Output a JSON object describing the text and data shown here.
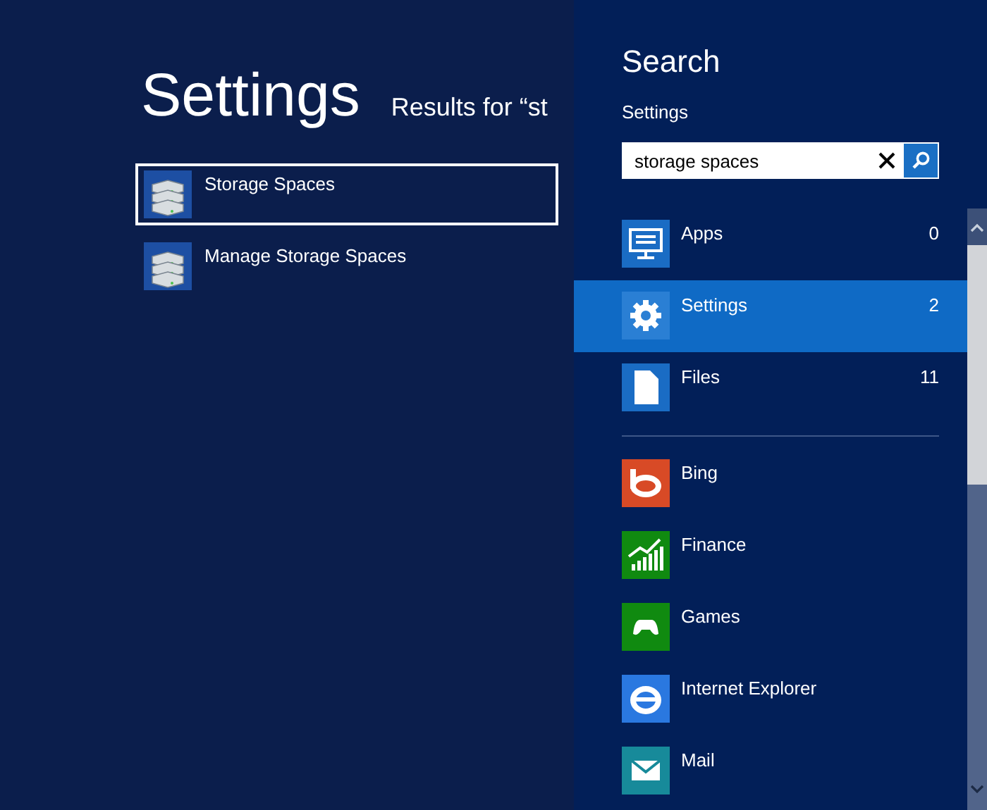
{
  "heading": "Settings",
  "results_for": "Results for “st",
  "results": [
    {
      "label": "Storage Spaces",
      "selected": true
    },
    {
      "label": "Manage Storage Spaces",
      "selected": false
    }
  ],
  "search": {
    "title": "Search",
    "scope": "Settings",
    "value": "storage spaces",
    "categories": [
      {
        "kind": "apps",
        "label": "Apps",
        "count": "0",
        "selected": false
      },
      {
        "kind": "settings",
        "label": "Settings",
        "count": "2",
        "selected": true
      },
      {
        "kind": "files",
        "label": "Files",
        "count": "11",
        "selected": false
      }
    ],
    "apps": [
      {
        "kind": "bing",
        "label": "Bing",
        "color": "#d84a26"
      },
      {
        "kind": "finance",
        "label": "Finance",
        "color": "#108a10"
      },
      {
        "kind": "games",
        "label": "Games",
        "color": "#108a10"
      },
      {
        "kind": "ie",
        "label": "Internet Explorer",
        "color": "#2a78e0"
      },
      {
        "kind": "mail",
        "label": "Mail",
        "color": "#178a9a"
      }
    ]
  }
}
